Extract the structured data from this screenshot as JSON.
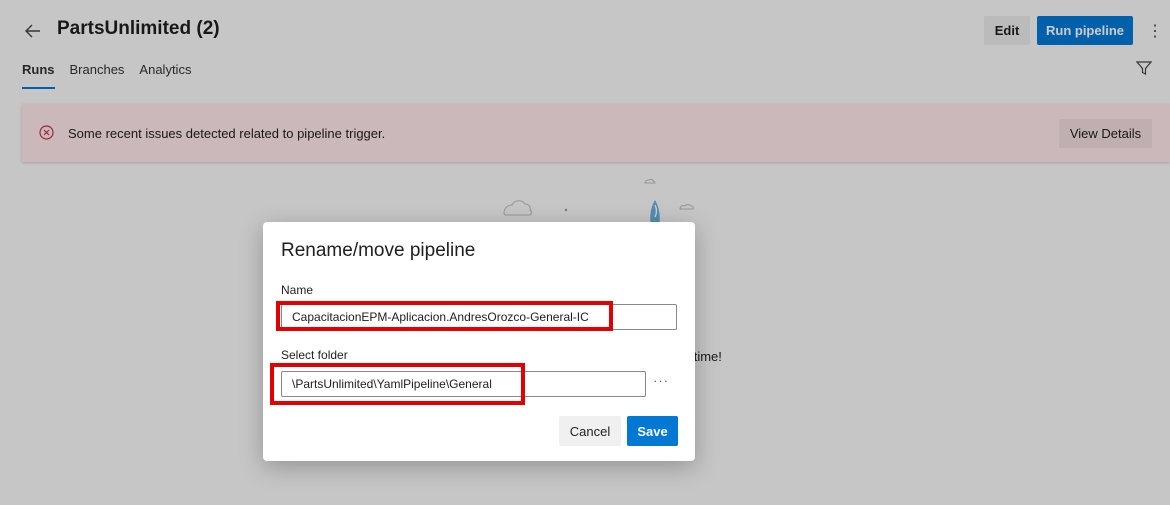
{
  "header": {
    "title": "PartsUnlimited (2)",
    "edit_label": "Edit",
    "run_label": "Run pipeline",
    "more_glyph": "⋮"
  },
  "tabs": [
    {
      "label": "Runs",
      "active": true
    },
    {
      "label": "Branches",
      "active": false
    },
    {
      "label": "Analytics",
      "active": false
    }
  ],
  "banner": {
    "message": "Some recent issues detected related to pipeline trigger.",
    "button_label": "View Details",
    "icon": "error-circle-icon"
  },
  "background": {
    "partial_text": "st time!"
  },
  "dialog": {
    "title": "Rename/move pipeline",
    "name_label": "Name",
    "name_value": "CapacitacionEPM-Aplicacion.AndresOrozco-General-IC",
    "folder_label": "Select folder",
    "folder_value": "\\PartsUnlimited\\YamlPipeline\\General",
    "folder_more_glyph": "···",
    "cancel_label": "Cancel",
    "save_label": "Save"
  },
  "colors": {
    "accent": "#0078d4",
    "banner_bg": "#fde7e9",
    "highlight": "#e00000"
  }
}
